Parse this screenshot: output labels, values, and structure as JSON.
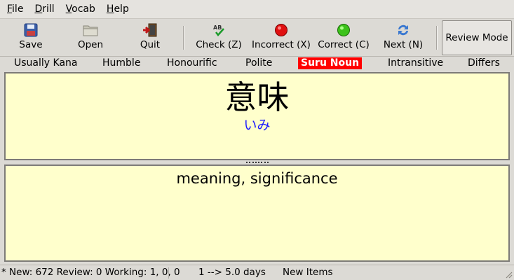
{
  "menu": {
    "items": [
      {
        "mnemonic": "F",
        "rest": "ile"
      },
      {
        "mnemonic": "D",
        "rest": "rill"
      },
      {
        "mnemonic": "V",
        "rest": "ocab"
      },
      {
        "mnemonic": "H",
        "rest": "elp"
      }
    ]
  },
  "toolbar": {
    "save": {
      "label": "Save",
      "icon": "floppy-disk-icon"
    },
    "open": {
      "label": "Open",
      "icon": "folder-icon"
    },
    "quit": {
      "label": "Quit",
      "icon": "exit-door-icon"
    },
    "check": {
      "label": "Check (Z)",
      "icon": "spell-check-icon"
    },
    "incorrect": {
      "label": "Incorrect (X)",
      "icon": "red-dot-icon"
    },
    "correct": {
      "label": "Correct (C)",
      "icon": "green-dot-icon"
    },
    "next": {
      "label": "Next (N)",
      "icon": "refresh-icon"
    },
    "review_mode": {
      "label": "Review Mode"
    }
  },
  "tags": {
    "items": [
      "Usually Kana",
      "Humble",
      "Honourific",
      "Polite",
      "Suru Noun",
      "Intransitive",
      "Differs"
    ],
    "active": "Suru Noun",
    "active_color": "#ff0000"
  },
  "card": {
    "kanji": "意味",
    "reading": "いみ",
    "reading_color": "#1a1aff",
    "meaning": "meaning, significance",
    "panel_color": "#ffffcc"
  },
  "status": {
    "counts": "* New: 672 Review: 0 Working: 1, 0, 0",
    "interval": "1 --> 5.0 days",
    "mode": "New Items"
  }
}
